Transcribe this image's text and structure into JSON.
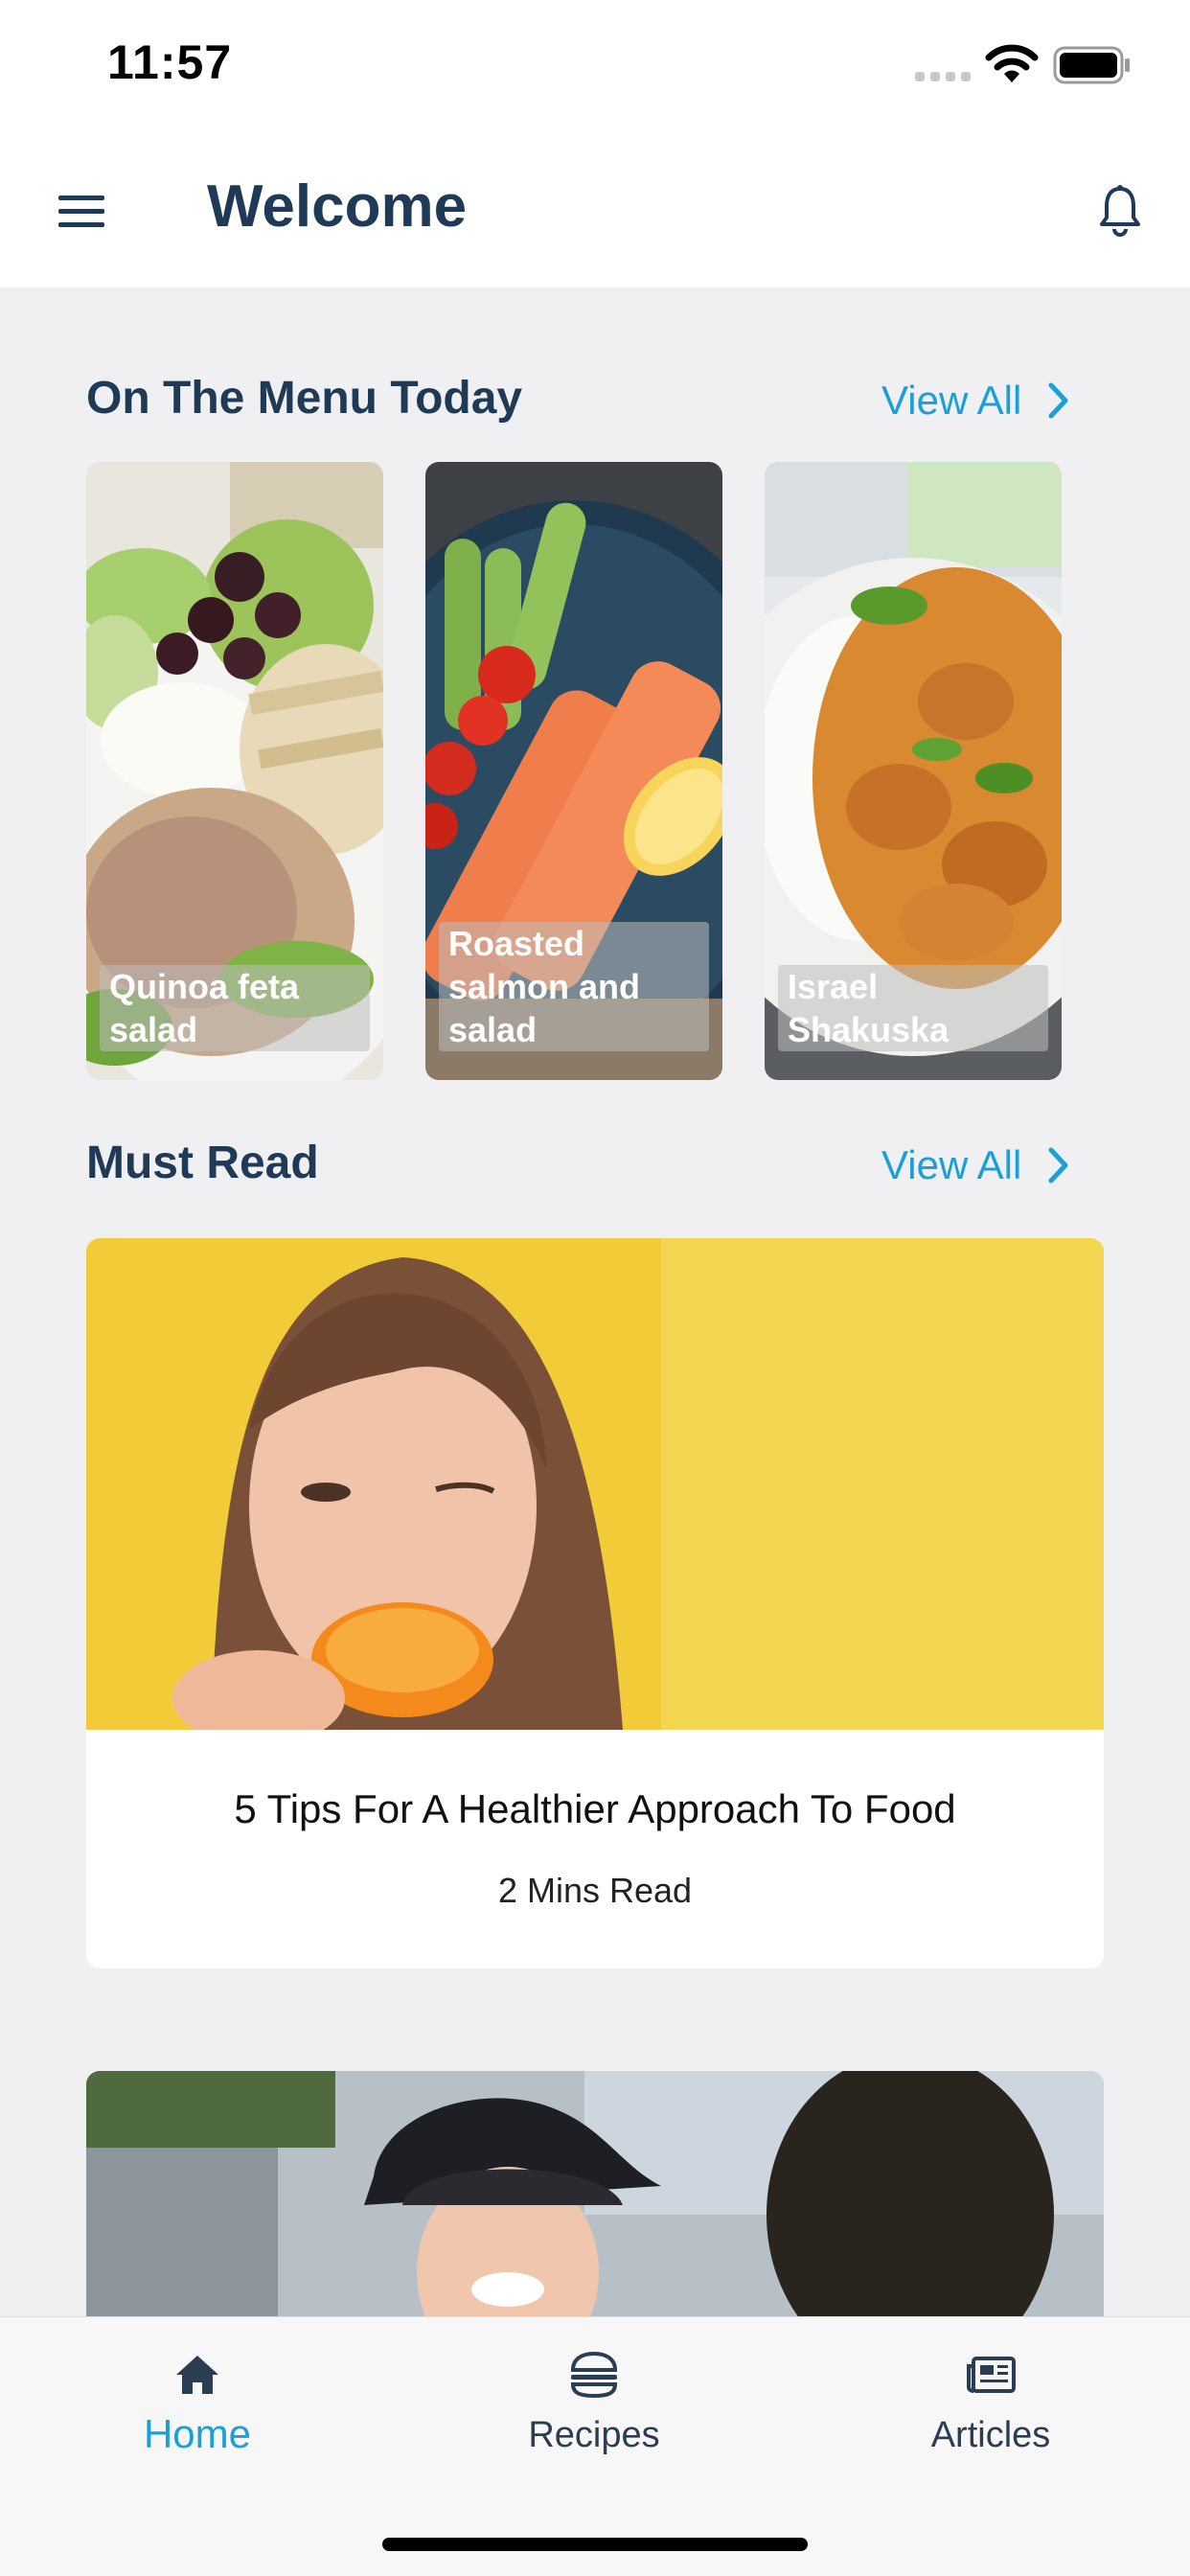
{
  "status_bar": {
    "time": "11:57"
  },
  "header": {
    "title": "Welcome",
    "menu_icon": "hamburger-icon",
    "notification_icon": "bell-icon"
  },
  "menu_section": {
    "title": "On The Menu Today",
    "view_all_label": "View All",
    "items": [
      {
        "label": "Quinoa feta salad"
      },
      {
        "label": "Roasted salmon and salad"
      },
      {
        "label": "Israel Shakuska"
      }
    ]
  },
  "must_read": {
    "title": "Must Read",
    "view_all_label": "View All",
    "articles": [
      {
        "title": "5 Tips For A Healthier Approach To Food",
        "read_time": "2 Mins Read"
      }
    ]
  },
  "tab_bar": {
    "tabs": [
      {
        "label": "Home",
        "icon": "home-icon",
        "active": true
      },
      {
        "label": "Recipes",
        "icon": "burger-icon",
        "active": false
      },
      {
        "label": "Articles",
        "icon": "newspaper-icon",
        "active": false
      }
    ]
  },
  "colors": {
    "accent": "#1aa0d6",
    "title": "#1e3a56",
    "background": "#f0f0f2"
  }
}
